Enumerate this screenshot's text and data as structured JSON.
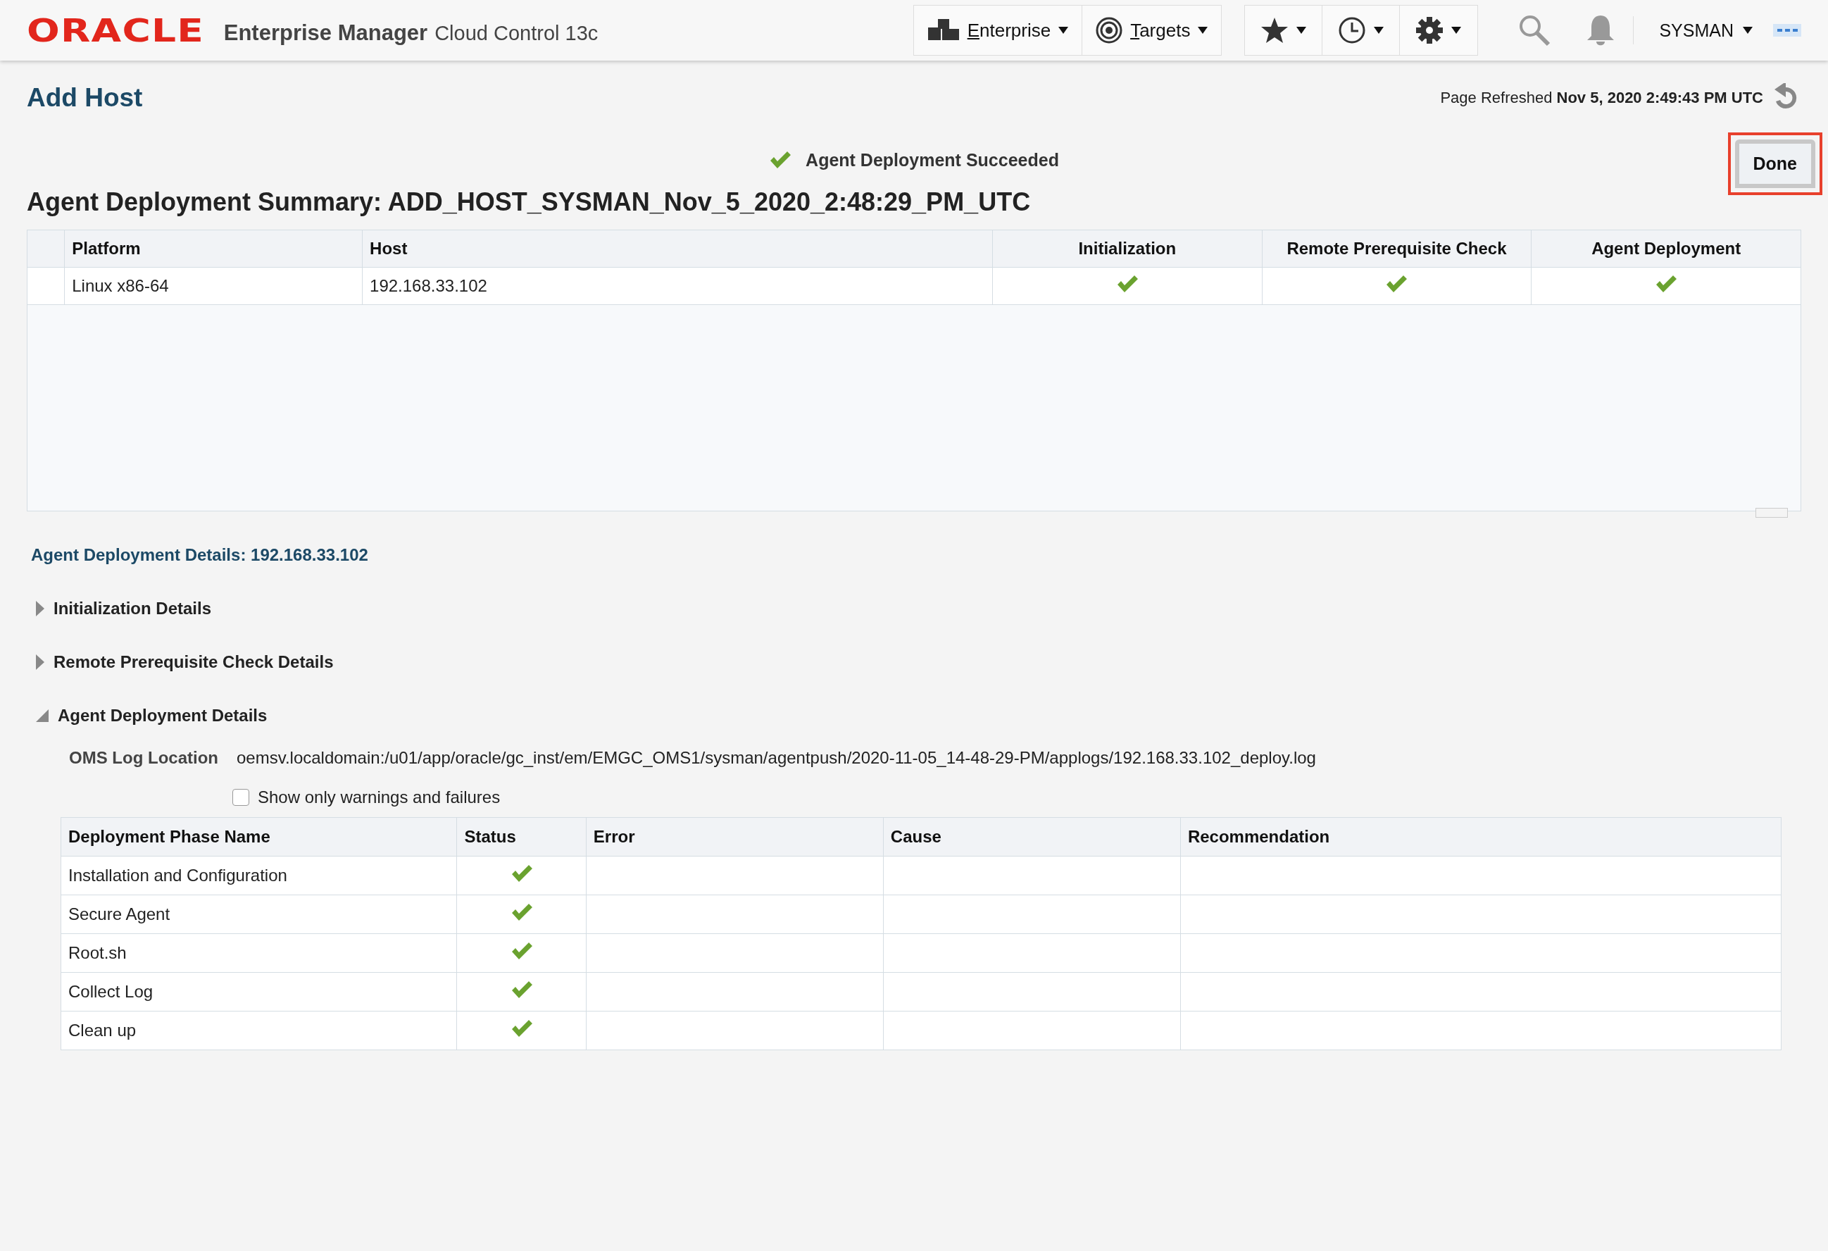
{
  "header": {
    "logo": "ORACLE",
    "product": "Enterprise Manager",
    "edition": "Cloud Control 13c",
    "menus": [
      {
        "label": "Enterprise",
        "kind": "enterprise"
      },
      {
        "label": "Targets",
        "kind": "targets"
      }
    ],
    "tools": [
      {
        "kind": "favorites"
      },
      {
        "kind": "history"
      },
      {
        "kind": "setup"
      }
    ],
    "user": "SYSMAN"
  },
  "page": {
    "title": "Add Host",
    "refreshed": "Page Refreshed **Nov 5, 2020 2:49:43 PM UTC**"
  },
  "message": {
    "succeeded": true,
    "text": "Agent Deployment Succeeded"
  },
  "done_button": {
    "label": "Done",
    "highlighted": true
  },
  "summary": {
    "title": "Agent Deployment Summary: ADD_HOST_SYSMAN_Nov_5_2020_2:48:29_PM_UTC",
    "columns": [
      "Platform",
      "Host",
      "Initialization",
      "Remote Prerequisite Check",
      "Agent Deployment"
    ],
    "rows": [
      {
        "platform": "Linux x86-64",
        "host": "192.168.33.102",
        "initialization_succeeded": true,
        "prerequisite_check_succeeded": true,
        "agent_deployment_succeeded": true
      }
    ]
  },
  "details": {
    "title": "Agent Deployment Details: 192.168.33.102",
    "sections": [
      {
        "label": "Initialization Details",
        "expanded": false
      },
      {
        "label": "Remote Prerequisite Check Details",
        "expanded": false
      },
      {
        "label": "Agent Deployment Details",
        "expanded": true
      }
    ],
    "log_label": "OMS Log Location",
    "log_value": "oemsv.localdomain:/u01/app/oracle/gc_inst/em/EMGC_OMS1/sysman/agentpush/2020-11-05_14-48-29-PM/applogs/192.168.33.102_deploy.log",
    "filter": {
      "label": "Show only warnings and failures",
      "checked": false
    },
    "columns": [
      "Deployment Phase Name",
      "Status",
      "Error",
      "Cause",
      "Recommendation"
    ],
    "rows": [
      {
        "phase": "Installation and Configuration",
        "succeeded": true
      },
      {
        "phase": "Secure Agent",
        "succeeded": true
      },
      {
        "phase": "Root.sh",
        "succeeded": true
      },
      {
        "phase": "Collect Log",
        "succeeded": true
      },
      {
        "phase": "Clean up",
        "succeeded": true
      }
    ]
  }
}
